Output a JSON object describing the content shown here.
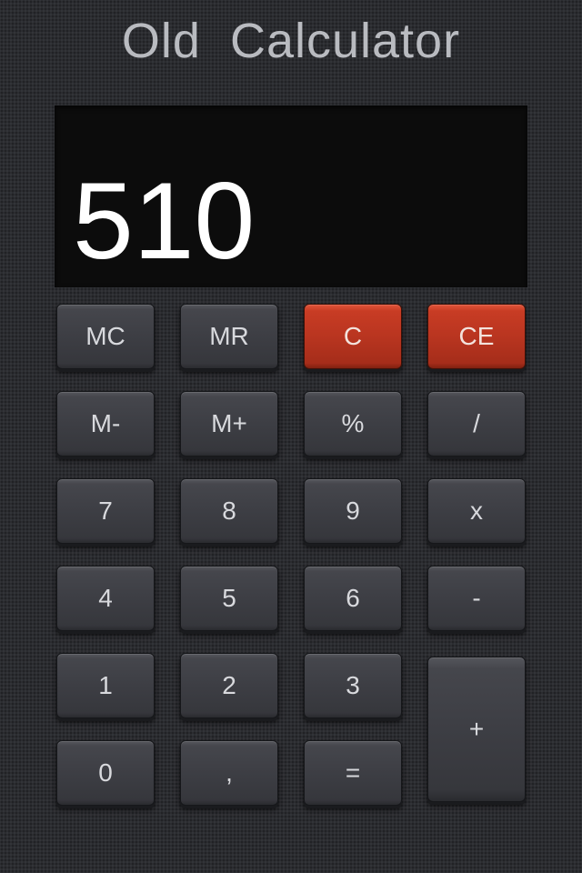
{
  "header": {
    "title": "Old  Calculator"
  },
  "display": {
    "value": "510"
  },
  "colors": {
    "background": "#2b2c30",
    "display_background": "#0c0c0c",
    "display_text": "#ffffff",
    "key_dark": "#3d3e44",
    "key_red": "#b93520",
    "key_text": "#d8d9dd",
    "title_text": "#b9bbc0"
  },
  "keys": {
    "mc": "MC",
    "mr": "MR",
    "c": "C",
    "ce": "CE",
    "m_minus": "M-",
    "m_plus": "M+",
    "percent": "%",
    "divide": "/",
    "seven": "7",
    "eight": "8",
    "nine": "9",
    "multiply": "x",
    "four": "4",
    "five": "5",
    "six": "6",
    "subtract": "-",
    "one": "1",
    "two": "2",
    "three": "3",
    "add": "+",
    "zero": "0",
    "comma": ",",
    "equals": "="
  }
}
